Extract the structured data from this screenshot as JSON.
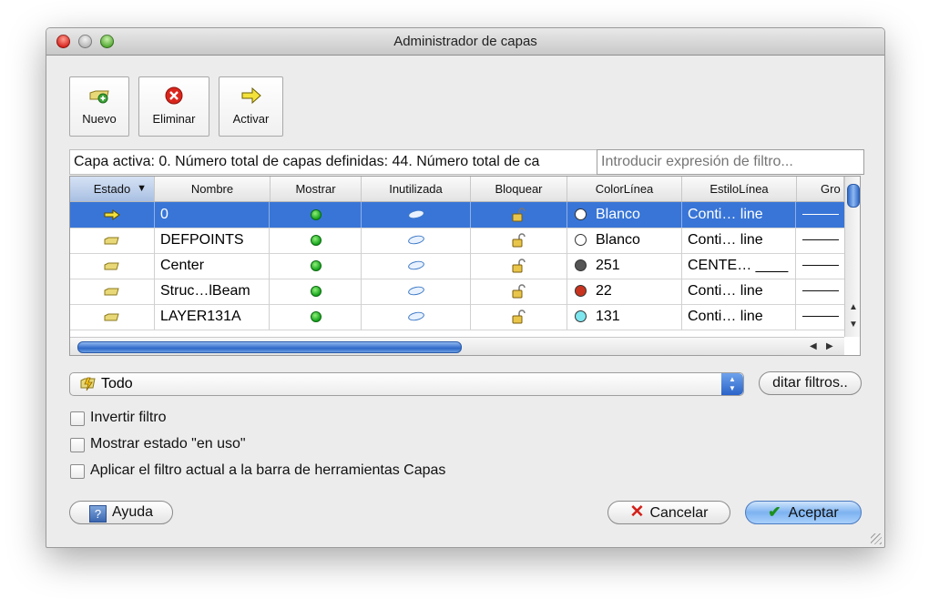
{
  "window": {
    "title": "Administrador de capas"
  },
  "toolbar": {
    "new_label": "Nuevo",
    "delete_label": "Eliminar",
    "activate_label": "Activar"
  },
  "info_text": "Capa activa: 0. Número total de capas definidas: 44. Número total de ca",
  "filter": {
    "placeholder": "Introducir expresión de filtro..."
  },
  "table": {
    "columns": [
      "Estado",
      "Nombre",
      "Mostrar",
      "Inutilizada",
      "Bloquear",
      "ColorLínea",
      "EstiloLínea",
      "Gro"
    ],
    "sort_indicator": "▼",
    "rows": [
      {
        "state": "active-arrow",
        "name": "0",
        "color_name": "Blanco",
        "color": "#ffffff",
        "linestyle": "Conti… line",
        "selected": true
      },
      {
        "state": "folder",
        "name": "DEFPOINTS",
        "color_name": "Blanco",
        "color": "#ffffff",
        "linestyle": "Conti… line",
        "selected": false
      },
      {
        "state": "folder",
        "name": "Center",
        "color_name": "251",
        "color": "#555555",
        "linestyle": "CENTE… ____",
        "selected": false
      },
      {
        "state": "folder",
        "name": "Struc…lBeam",
        "color_name": "22",
        "color": "#c8341f",
        "linestyle": "Conti… line",
        "selected": false
      },
      {
        "state": "folder",
        "name": "LAYER131A",
        "color_name": "131",
        "color": "#7ee6ef",
        "linestyle": "Conti… line",
        "selected": false
      }
    ]
  },
  "filter_select": {
    "value": "Todo",
    "edit_label": "ditar filtros.."
  },
  "options": [
    {
      "label": "Invertir filtro",
      "checked": false
    },
    {
      "label": "Mostrar estado \"en uso\"",
      "checked": false
    },
    {
      "label": "Aplicar el filtro actual a la barra de herramientas Capas",
      "checked": false
    }
  ],
  "buttons": {
    "help": "Ayuda",
    "help_glyph": "?",
    "cancel": "Cancelar",
    "accept": "Aceptar"
  },
  "colors": {
    "selection": "#3875d7",
    "accent": "#2f69c8"
  }
}
